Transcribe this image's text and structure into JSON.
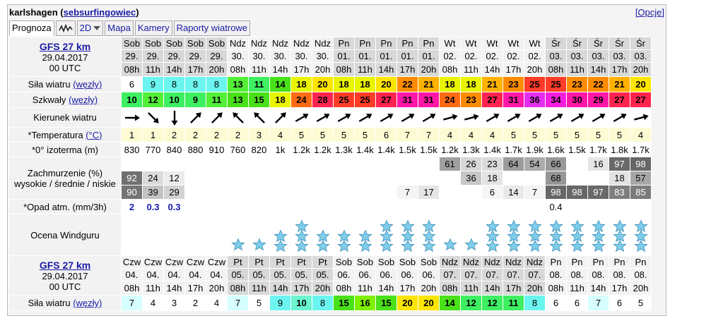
{
  "header": {
    "spot": "karlshagen",
    "user": "sebsurfingowiec",
    "options": "[Opcje]"
  },
  "tabs": [
    {
      "label": "Prognoza",
      "name": "tab-prognoza",
      "icon": ""
    },
    {
      "label": "",
      "name": "tab-graph",
      "icon": "wave-graph-icon"
    },
    {
      "label": "2D",
      "name": "tab-2d",
      "icon": "dropdown-arrow-icon"
    },
    {
      "label": "Mapa",
      "name": "tab-mapa",
      "icon": ""
    },
    {
      "label": "Kamery",
      "name": "tab-kamery",
      "icon": ""
    },
    {
      "label": "Raporty wiatrowe",
      "name": "tab-raporty",
      "icon": ""
    }
  ],
  "block1": {
    "model": "GFS 27 km",
    "date": "29.04.2017",
    "utc": "00 UTC",
    "days": [
      "Sob",
      "Sob",
      "Sob",
      "Sob",
      "Sob",
      "Ndz",
      "Ndz",
      "Ndz",
      "Ndz",
      "Ndz",
      "Pn",
      "Pn",
      "Pn",
      "Pn",
      "Pn",
      "Wt",
      "Wt",
      "Wt",
      "Wt",
      "Wt",
      "Śr",
      "Śr",
      "Śr",
      "Śr",
      "Śr"
    ],
    "dates": [
      "29.",
      "29.",
      "29.",
      "29.",
      "29.",
      "30.",
      "30.",
      "30.",
      "30.",
      "30.",
      "01.",
      "01.",
      "01.",
      "01.",
      "01.",
      "02.",
      "02.",
      "02.",
      "02.",
      "02.",
      "03.",
      "03.",
      "03.",
      "03.",
      "03."
    ],
    "hours": [
      "08h",
      "11h",
      "14h",
      "17h",
      "20h",
      "08h",
      "11h",
      "14h",
      "17h",
      "20h",
      "08h",
      "11h",
      "14h",
      "17h",
      "20h",
      "08h",
      "11h",
      "14h",
      "17h",
      "20h",
      "08h",
      "11h",
      "14h",
      "17h",
      "20h"
    ],
    "shade": [
      0,
      0,
      0,
      0,
      0,
      1,
      1,
      1,
      1,
      1,
      0,
      0,
      0,
      0,
      0,
      1,
      1,
      1,
      1,
      1,
      0,
      0,
      0,
      0,
      0
    ],
    "labels": {
      "wind": "Siła wiatru",
      "wind_unit": "(węzły)",
      "gust": "Szkwały",
      "gust_unit": "(węzły)",
      "dir": "Kierunek wiatru",
      "temp": "*Temperatura",
      "temp_unit": "(°C)",
      "iso": "*0° izoterma (m)",
      "cloud1": "Zachmurzenie (%)",
      "cloud2": "wysokie / średnie / niskie",
      "rain": "*Opad atm. (mm/3h)",
      "rating": "Ocena Windguru"
    },
    "wind": [
      "6",
      "9",
      "8",
      "8",
      "8",
      "13",
      "11",
      "14",
      "18",
      "20",
      "18",
      "18",
      "20",
      "22",
      "21",
      "18",
      "18",
      "21",
      "23",
      "25",
      "25",
      "23",
      "22",
      "21",
      "20"
    ],
    "gust": [
      "10",
      "12",
      "10",
      "9",
      "11",
      "13",
      "15",
      "18",
      "24",
      "28",
      "25",
      "25",
      "27",
      "31",
      "31",
      "24",
      "23",
      "27",
      "31",
      "36",
      "34",
      "30",
      "29",
      "27",
      "27"
    ],
    "dir": [
      90,
      135,
      180,
      45,
      45,
      315,
      315,
      45,
      60,
      60,
      60,
      60,
      60,
      60,
      60,
      75,
      75,
      60,
      60,
      60,
      60,
      60,
      60,
      60,
      75
    ],
    "temp": [
      "1",
      "1",
      "2",
      "2",
      "2",
      "2",
      "3",
      "4",
      "5",
      "5",
      "5",
      "5",
      "6",
      "7",
      "7",
      "4",
      "4",
      "4",
      "5",
      "5",
      "5",
      "5",
      "5",
      "5",
      "4"
    ],
    "iso": [
      "830",
      "770",
      "840",
      "880",
      "910",
      "760",
      "820",
      "1k",
      "1.2k",
      "1.2k",
      "1.3k",
      "1.4k",
      "1.4k",
      "1.5k",
      "1.5k",
      "1.2k",
      "1.3k",
      "1.4k",
      "1.7k",
      "1.9k",
      "1.6k",
      "1.5k",
      "1.7k",
      "1.8k",
      "1.7k"
    ],
    "cloud_high": [
      "",
      "",
      "",
      "",
      "",
      "",
      "",
      "",
      "",
      "",
      "",
      "",
      "",
      "",
      "",
      "61",
      "26",
      "23",
      "64",
      "54",
      "66",
      "",
      "16",
      "97",
      "98"
    ],
    "cloud_mid": [
      "92",
      "24",
      "12",
      "",
      "",
      "",
      "",
      "",
      "",
      "",
      "",
      "",
      "",
      "",
      "",
      "",
      "36",
      "18",
      "",
      "",
      "68",
      "",
      "",
      "18",
      "57"
    ],
    "cloud_low": [
      "90",
      "39",
      "29",
      "",
      "",
      "",
      "",
      "",
      "",
      "",
      "",
      "",
      "",
      "7",
      "17",
      "",
      "",
      "6",
      "14",
      "7",
      "98",
      "98",
      "97",
      "83",
      "85"
    ],
    "rain": [
      "2",
      "0.3",
      "0.3",
      "",
      "",
      "",
      "",
      "",
      "",
      "",
      "",
      "",
      "",
      "",
      "",
      "",
      "",
      "",
      "",
      "",
      "0.4",
      "",
      "",
      "",
      ""
    ],
    "stars": [
      0,
      0,
      0,
      0,
      0,
      1,
      1,
      2,
      3,
      2,
      2,
      2,
      3,
      3,
      3,
      1,
      1,
      3,
      3,
      3,
      3,
      3,
      3,
      3,
      3
    ]
  },
  "block2": {
    "model": "GFS 27 km",
    "date": "29.04.2017",
    "utc": "00 UTC",
    "days": [
      "Czw",
      "Czw",
      "Czw",
      "Czw",
      "Czw",
      "Pt",
      "Pt",
      "Pt",
      "Pt",
      "Pt",
      "Sob",
      "Sob",
      "Sob",
      "Sob",
      "Sob",
      "Ndz",
      "Ndz",
      "Ndz",
      "Ndz",
      "Ndz",
      "Pn",
      "Pn",
      "Pn",
      "Pn",
      "Pn"
    ],
    "dates": [
      "04.",
      "04.",
      "04.",
      "04.",
      "04.",
      "05.",
      "05.",
      "05.",
      "05.",
      "05.",
      "06.",
      "06.",
      "06.",
      "06.",
      "06.",
      "07.",
      "07.",
      "07.",
      "07.",
      "07.",
      "08.",
      "08.",
      "08.",
      "08.",
      "08."
    ],
    "hours": [
      "08h",
      "11h",
      "14h",
      "17h",
      "20h",
      "08h",
      "11h",
      "14h",
      "17h",
      "20h",
      "08h",
      "11h",
      "14h",
      "17h",
      "20h",
      "08h",
      "11h",
      "14h",
      "17h",
      "20h",
      "08h",
      "11h",
      "14h",
      "17h",
      "20h"
    ],
    "shade": [
      1,
      1,
      1,
      1,
      1,
      0,
      0,
      0,
      0,
      0,
      1,
      1,
      1,
      1,
      1,
      0,
      0,
      0,
      0,
      0,
      1,
      1,
      1,
      1,
      1
    ],
    "wind_label": "Siła wiatru",
    "wind_unit": "(węzły)",
    "wind": [
      "7",
      "4",
      "3",
      "2",
      "4",
      "7",
      "5",
      "9",
      "10",
      "8",
      "15",
      "16",
      "15",
      "20",
      "20",
      "14",
      "12",
      "12",
      "11",
      "8",
      "6",
      "6",
      "7",
      "6",
      "5"
    ]
  },
  "colors": {
    "link": "#1a1aa6",
    "star": "#7ecdea",
    "star_stroke": "#3f8fb8"
  }
}
